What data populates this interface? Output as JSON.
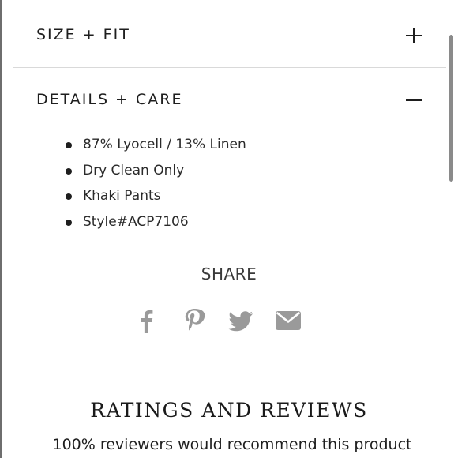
{
  "accordion": {
    "size_fit": {
      "title": "SIZE + FIT",
      "state": "collapsed",
      "icon": "plus-icon"
    },
    "details_care": {
      "title": "DETAILS + CARE",
      "state": "expanded",
      "icon": "minus-icon",
      "items": [
        "87% Lyocell / 13% Linen",
        "Dry Clean Only",
        "Khaki Pants",
        "Style#ACP7106"
      ]
    }
  },
  "share": {
    "label": "SHARE",
    "icons": [
      "facebook-icon",
      "pinterest-icon",
      "twitter-icon",
      "email-icon"
    ],
    "icon_color": "#9a9a9a"
  },
  "reviews": {
    "title": "RATINGS AND REVIEWS",
    "recommend_text": "100% reviewers would recommend this product"
  }
}
